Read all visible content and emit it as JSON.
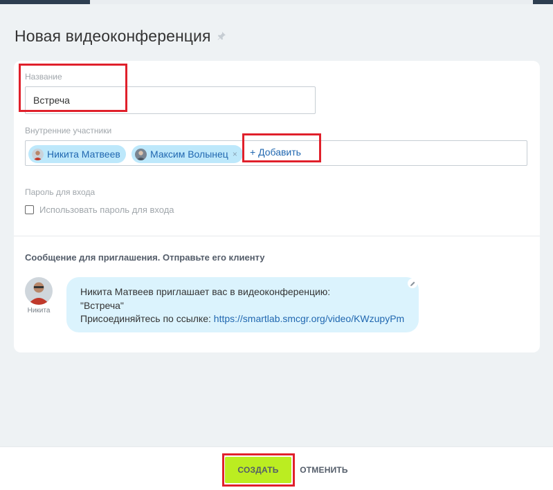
{
  "dialog": {
    "title": "Новая видеоконференция",
    "pin_icon": "pin-icon"
  },
  "form": {
    "name_label": "Название",
    "name_value": "Встреча",
    "participants_label": "Внутренние участники",
    "participants": [
      {
        "name": "Никита Матвеев",
        "removable": false
      },
      {
        "name": "Максим Волынец",
        "removable": true,
        "remove_glyph": "×"
      }
    ],
    "add_label": "+ Добавить",
    "password_label": "Пароль для входа",
    "password_checkbox_label": "Использовать пароль для входа",
    "password_checked": false
  },
  "invite": {
    "title": "Сообщение для приглашения. Отправьте его клиенту",
    "sender_name": "Никита",
    "line1": "Никита Матвеев приглашает вас в видеоконференцию:",
    "line2": "\"Встреча\"",
    "line3_prefix": "Присоединяйтесь по ссылке: ",
    "link": "https://smartlab.smcgr.org/video/KWzupyPm"
  },
  "footer": {
    "create_label": "СОЗДАТЬ",
    "cancel_label": "ОТМЕНИТЬ"
  },
  "colors": {
    "accent_green": "#bbed21",
    "link_blue": "#2067b0",
    "chip_bg": "#bde8fb",
    "bubble_bg": "#dbf3fd",
    "highlight_red": "#e0202b"
  }
}
